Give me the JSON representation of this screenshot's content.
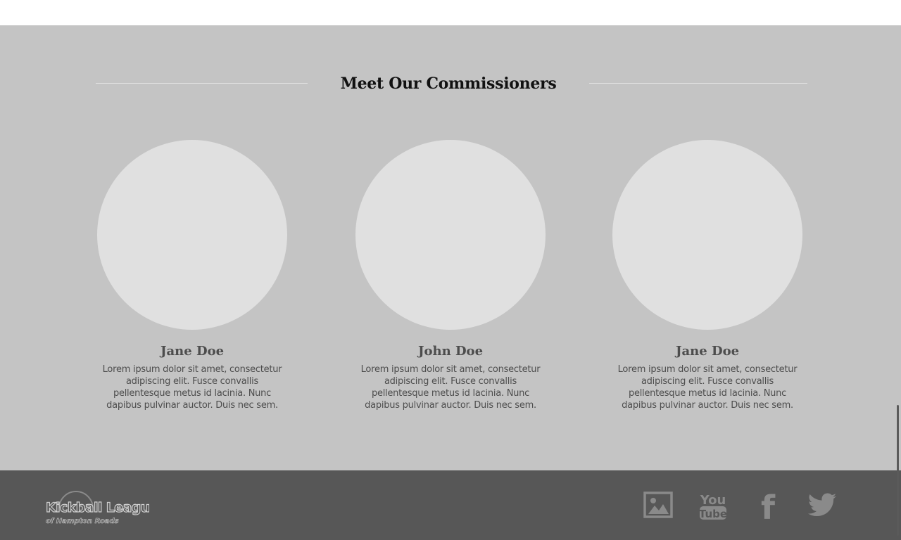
{
  "section": {
    "title": "Meet Our Commissioners"
  },
  "commissioners": [
    {
      "name": "Jane Doe",
      "bio": "Lorem ipsum dolor sit amet, consectetur adipiscing elit. Fusce convallis pellentesque metus id lacinia. Nunc dapibus pulvinar auctor. Duis nec sem."
    },
    {
      "name": "John Doe",
      "bio": "Lorem ipsum dolor sit amet, consectetur adipiscing elit. Fusce convallis pellentesque metus id lacinia. Nunc dapibus pulvinar auctor. Duis nec sem."
    },
    {
      "name": "Jane Doe",
      "bio": "Lorem ipsum dolor sit amet, consectetur adipiscing elit. Fusce convallis pellentesque metus id lacinia. Nunc dapibus pulvinar auctor. Duis nec sem."
    }
  ],
  "footer": {
    "logo_line1": "Kickball League",
    "logo_line2": "of Hampton Roads",
    "social": [
      {
        "icon": "photo-gallery-icon",
        "label": "Photos"
      },
      {
        "icon": "youtube-icon",
        "label": "YouTube",
        "text_top": "You",
        "text_bottom": "Tube"
      },
      {
        "icon": "facebook-icon",
        "label": "Facebook",
        "glyph": "f"
      },
      {
        "icon": "twitter-icon",
        "label": "Twitter"
      }
    ]
  },
  "colors": {
    "main_bg": "#c4c4c4",
    "portrait_placeholder": "#e0e0e0",
    "footer_bg": "#575757",
    "footer_icon": "#8a8a8a"
  }
}
